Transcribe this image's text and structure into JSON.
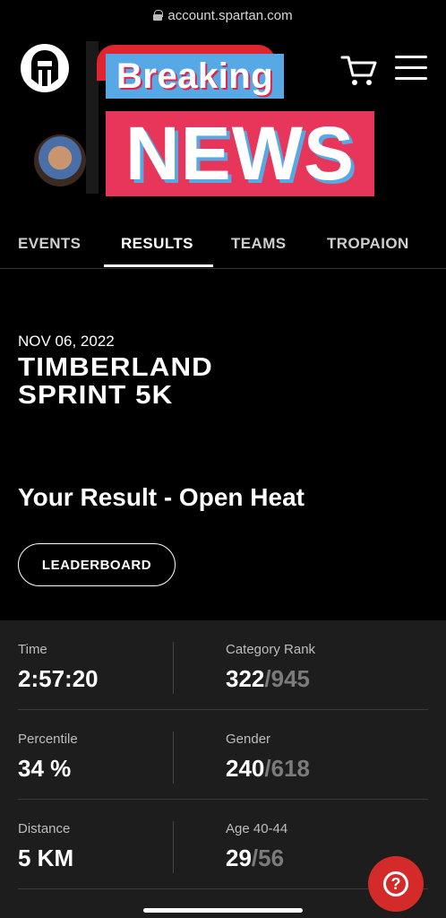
{
  "browser": {
    "url": "account.spartan.com"
  },
  "header": {
    "logo_icon": "spartan-helmet-logo",
    "cart_icon": "cart-icon",
    "menu_icon": "hamburger-menu-icon",
    "sticker_line1": "Breaking",
    "sticker_line2": "NEWS"
  },
  "tabs": [
    {
      "label": "EVENTS",
      "active": false
    },
    {
      "label": "RESULTS",
      "active": true
    },
    {
      "label": "TEAMS",
      "active": false
    },
    {
      "label": "TROPAION",
      "active": false
    }
  ],
  "event": {
    "date": "NOV 06, 2022",
    "title_line1": "TIMBERLAND",
    "title_line2": "SPRINT 5K"
  },
  "result": {
    "heading": "Your Result - Open Heat",
    "leaderboard_label": "LEADERBOARD"
  },
  "stats": {
    "time_label": "Time",
    "time_value": "2:57:20",
    "category_rank_label": "Category Rank",
    "category_rank_value": "322",
    "category_rank_total": "/945",
    "percentile_label": "Percentile",
    "percentile_value": "34 %",
    "gender_label": "Gender",
    "gender_value": "240",
    "gender_total": "/618",
    "distance_label": "Distance",
    "distance_value": "5 KM",
    "age_label": "Age 40-44",
    "age_value": "29",
    "age_total": "/56"
  },
  "help": {
    "icon": "help-question-icon"
  },
  "colors": {
    "background": "#000000",
    "panel": "#1d1d1d",
    "help_red": "#d42a2a",
    "muted_total": "#7b7b7b"
  }
}
